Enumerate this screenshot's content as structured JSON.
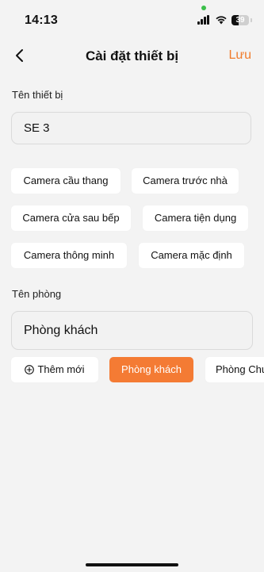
{
  "status": {
    "time": "14:13",
    "battery": "39",
    "battery_level": 0.39
  },
  "header": {
    "title": "Cài đặt thiết bị",
    "save_label": "Lưu"
  },
  "device": {
    "label": "Tên thiết bị",
    "value": "SE 3",
    "suggestions": [
      "Camera cầu thang",
      "Camera trước nhà",
      "Camera cửa sau bếp",
      "Camera tiện dụng",
      "Camera thông minh",
      "Camera mặc định"
    ]
  },
  "room": {
    "label": "Tên phòng",
    "value": "Phòng khách",
    "add_label": "Thêm mới",
    "options": [
      "Phòng khách",
      "Phòng Chung"
    ],
    "selected": "Phòng khách"
  },
  "colors": {
    "accent": "#f47b34",
    "background": "#f3f3f3"
  },
  "icons": [
    "back-arrow-icon",
    "plus-circle-icon",
    "signal-icon",
    "wifi-icon",
    "battery-icon"
  ]
}
